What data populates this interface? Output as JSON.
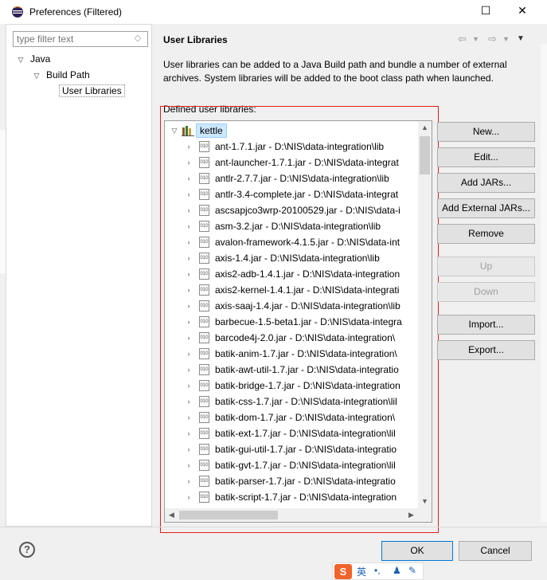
{
  "window": {
    "title": "Preferences (Filtered)",
    "maximize_glyph": "☐",
    "close_glyph": "✕"
  },
  "filter": {
    "placeholder": "type filter text"
  },
  "nav_tree": {
    "java": "Java",
    "build_path": "Build Path",
    "user_libraries": "User Libraries"
  },
  "page": {
    "title": "User Libraries",
    "description": "User libraries can be added to a Java Build path and bundle a number of external archives. System libraries will be added to the boot class path when launched.",
    "defined_label": "Defined user libraries:"
  },
  "library_tree": {
    "root": "kettle",
    "items": [
      "ant-1.7.1.jar - D:\\NIS\\data-integration\\lib",
      "ant-launcher-1.7.1.jar - D:\\NIS\\data-integrat",
      "antlr-2.7.7.jar - D:\\NIS\\data-integration\\lib",
      "antlr-3.4-complete.jar - D:\\NIS\\data-integrat",
      "ascsapjco3wrp-20100529.jar - D:\\NIS\\data-i",
      "asm-3.2.jar - D:\\NIS\\data-integration\\lib",
      "avalon-framework-4.1.5.jar - D:\\NIS\\data-int",
      "axis-1.4.jar - D:\\NIS\\data-integration\\lib",
      "axis2-adb-1.4.1.jar - D:\\NIS\\data-integration",
      "axis2-kernel-1.4.1.jar - D:\\NIS\\data-integrati",
      "axis-saaj-1.4.jar - D:\\NIS\\data-integration\\lib",
      "barbecue-1.5-beta1.jar - D:\\NIS\\data-integra",
      "barcode4j-2.0.jar - D:\\NIS\\data-integration\\",
      "batik-anim-1.7.jar - D:\\NIS\\data-integration\\",
      "batik-awt-util-1.7.jar - D:\\NIS\\data-integratio",
      "batik-bridge-1.7.jar - D:\\NIS\\data-integration",
      "batik-css-1.7.jar - D:\\NIS\\data-integration\\lil",
      "batik-dom-1.7.jar - D:\\NIS\\data-integration\\",
      "batik-ext-1.7.jar - D:\\NIS\\data-integration\\lil",
      "batik-gui-util-1.7.jar - D:\\NIS\\data-integratio",
      "batik-gvt-1.7.jar - D:\\NIS\\data-integration\\lil",
      "batik-parser-1.7.jar - D:\\NIS\\data-integratio",
      "batik-script-1.7.jar - D:\\NIS\\data-integration"
    ]
  },
  "buttons": {
    "new": "New...",
    "edit": "Edit...",
    "add_jars": "Add JARs...",
    "add_external_jars": "Add External JARs...",
    "remove": "Remove",
    "up": "Up",
    "down": "Down",
    "import": "Import...",
    "export": "Export..."
  },
  "footer": {
    "help": "?",
    "ok": "OK",
    "cancel": "Cancel"
  },
  "ime": {
    "logo": "S",
    "mode": "英",
    "punct": "•,"
  },
  "colors": {
    "highlight_frame": "#e31b1b",
    "selection_bg": "#cce8ff",
    "ok_border": "#0078d7"
  }
}
